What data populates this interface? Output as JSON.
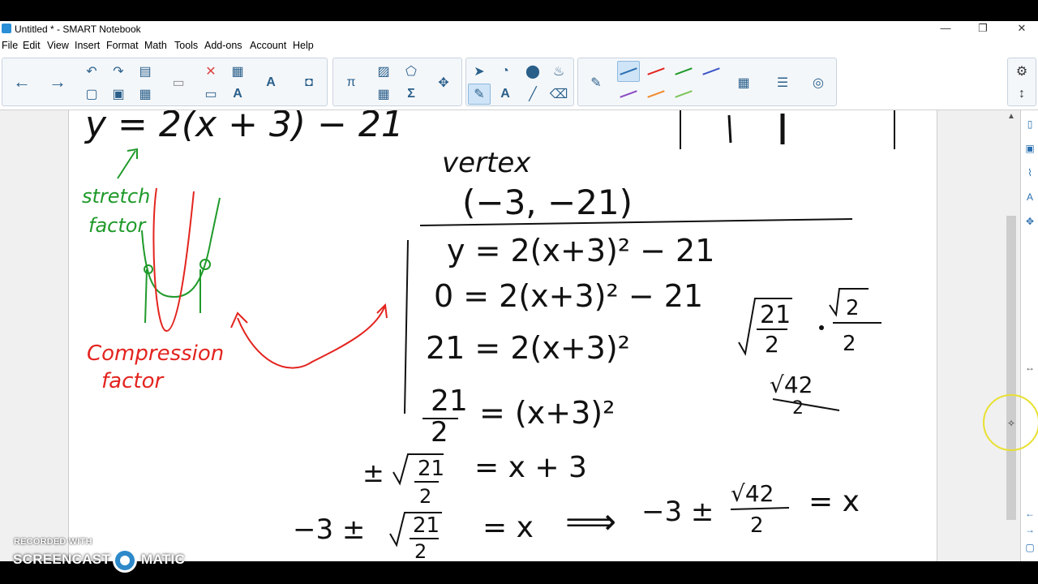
{
  "window": {
    "title": "Untitled * - SMART Notebook"
  },
  "menu": [
    "File",
    "Edit",
    "View",
    "Insert",
    "Format",
    "Math",
    "Tools",
    "Add-ons",
    "Account",
    "Help"
  ],
  "window_controls": {
    "minimize": "—",
    "restore": "❐",
    "close": "✕"
  },
  "toolbar": {
    "nav": {
      "back": "←",
      "forward": "→"
    },
    "pi": "π",
    "sigma": "Σ",
    "text_tool": "A"
  },
  "watermark": {
    "line1": "RECORDED WITH",
    "line2a": "SCREENCAST",
    "line2b": "MATIC"
  },
  "page": {
    "top_eq": "y = 2(x + 3) − 21",
    "vertex_label": "vertex",
    "vertex_value": "(−3, −21)",
    "stretch_label_1": "stretch",
    "stretch_label_2": "factor",
    "compression_label_1": "Compression",
    "compression_label_2": "factor",
    "step1": "y = 2(x+3)² − 21",
    "step2": "0 = 2(x+3)² − 21",
    "step3": "21 = 2(x+3)²",
    "step4_num": "21",
    "step4_den": "2",
    "step4_rhs": "= (x+3)²",
    "step5_pm": "±",
    "step5_rhs": "= x + 3",
    "step6_lhs": "−3 ±",
    "step6_rhs": "= x",
    "arrow": "⟹",
    "answer_lhs": "−3 ±",
    "answer_num": "√42",
    "answer_den": "2",
    "answer_rhs": "= x",
    "side_frac_num": "21",
    "side_frac_den": "2",
    "side_mult_num": "2",
    "side_mult_den": "2",
    "side_result_num": "√42",
    "side_result_den": "2"
  },
  "colors": {
    "ink": "#111111",
    "green": "#1f9a2a",
    "red": "#e3241f",
    "accent": "#2a6fb0"
  }
}
